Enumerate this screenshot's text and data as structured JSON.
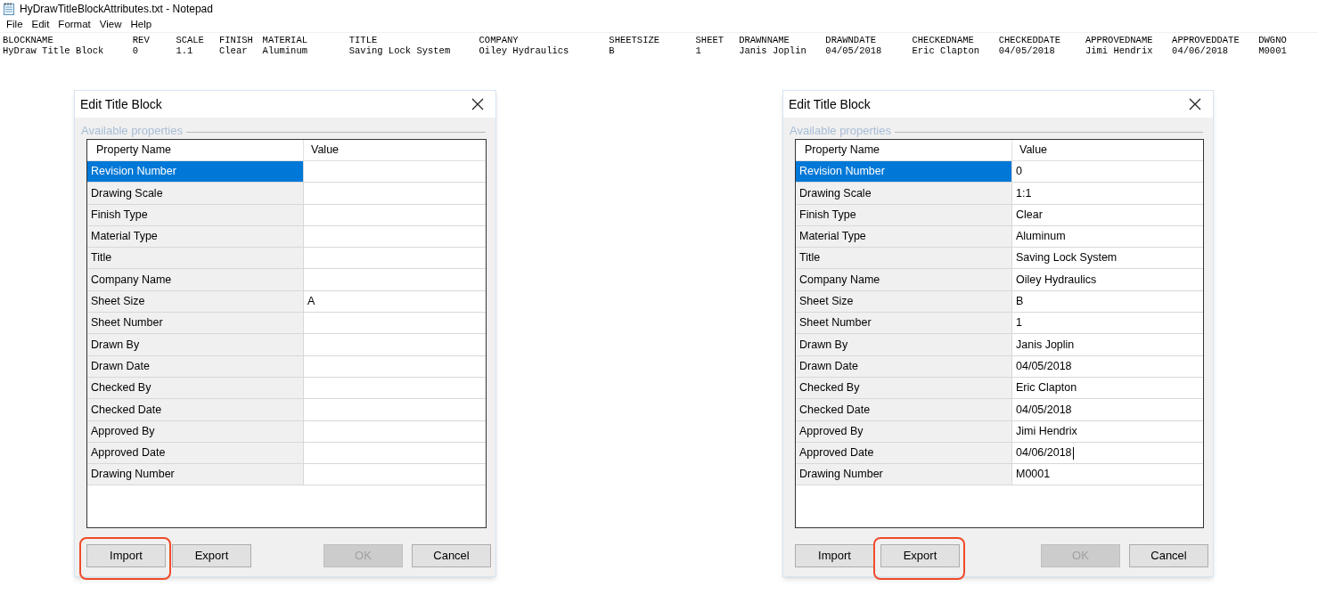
{
  "notepad": {
    "title": "HyDrawTitleBlockAttributes.txt - Notepad",
    "menu": [
      "File",
      "Edit",
      "Format",
      "View",
      "Help"
    ],
    "columns": [
      {
        "header": "BLOCKNAME",
        "value": "HyDraw Title Block"
      },
      {
        "header": "REV",
        "value": "0"
      },
      {
        "header": "SCALE",
        "value": "1.1"
      },
      {
        "header": "FINISH",
        "value": "Clear"
      },
      {
        "header": "MATERIAL",
        "value": "Aluminum"
      },
      {
        "header": "TITLE",
        "value": "Saving Lock System"
      },
      {
        "header": "COMPANY",
        "value": "Oiley Hydraulics"
      },
      {
        "header": "SHEETSIZE",
        "value": "B"
      },
      {
        "header": "SHEET",
        "value": "1"
      },
      {
        "header": "DRAWNNAME",
        "value": "Janis Joplin"
      },
      {
        "header": "DRAWNDATE",
        "value": "04/05/2018"
      },
      {
        "header": "CHECKEDNAME",
        "value": "Eric Clapton"
      },
      {
        "header": "CHECKEDDATE",
        "value": "04/05/2018"
      },
      {
        "header": "APPROVEDNAME",
        "value": "Jimi Hendrix"
      },
      {
        "header": "APPROVEDDATE",
        "value": "04/06/2018"
      },
      {
        "header": "DWGNO",
        "value": "M0001"
      }
    ]
  },
  "dialogs": [
    {
      "title": "Edit Title Block",
      "group_label": "Available properties",
      "columns": [
        "Property Name",
        "Value"
      ],
      "rows": [
        {
          "name": "Revision Number",
          "value": "",
          "selected": true,
          "caret": false
        },
        {
          "name": "Drawing Scale",
          "value": "",
          "selected": false,
          "caret": false
        },
        {
          "name": "Finish Type",
          "value": "",
          "selected": false,
          "caret": false
        },
        {
          "name": "Material Type",
          "value": "",
          "selected": false,
          "caret": false
        },
        {
          "name": "Title",
          "value": "",
          "selected": false,
          "caret": false
        },
        {
          "name": "Company Name",
          "value": "",
          "selected": false,
          "caret": false
        },
        {
          "name": "Sheet Size",
          "value": "A",
          "selected": false,
          "caret": false
        },
        {
          "name": "Sheet Number",
          "value": "",
          "selected": false,
          "caret": false
        },
        {
          "name": "Drawn By",
          "value": "",
          "selected": false,
          "caret": false
        },
        {
          "name": "Drawn Date",
          "value": "",
          "selected": false,
          "caret": false
        },
        {
          "name": "Checked By",
          "value": "",
          "selected": false,
          "caret": false
        },
        {
          "name": "Checked Date",
          "value": "",
          "selected": false,
          "caret": false
        },
        {
          "name": "Approved By",
          "value": "",
          "selected": false,
          "caret": false
        },
        {
          "name": "Approved Date",
          "value": "",
          "selected": false,
          "caret": false
        },
        {
          "name": "Drawing Number",
          "value": "",
          "selected": false,
          "caret": false
        }
      ],
      "buttons": [
        {
          "label": "Import",
          "disabled": false,
          "highlighted": true
        },
        {
          "label": "Export",
          "disabled": false,
          "highlighted": false
        },
        {
          "label": "OK",
          "disabled": true,
          "highlighted": false
        },
        {
          "label": "Cancel",
          "disabled": false,
          "highlighted": false
        }
      ]
    },
    {
      "title": "Edit Title Block",
      "group_label": "Available properties",
      "columns": [
        "Property Name",
        "Value"
      ],
      "rows": [
        {
          "name": "Revision Number",
          "value": "0",
          "selected": true,
          "caret": false
        },
        {
          "name": "Drawing Scale",
          "value": "1:1",
          "selected": false,
          "caret": false
        },
        {
          "name": "Finish Type",
          "value": "Clear",
          "selected": false,
          "caret": false
        },
        {
          "name": "Material Type",
          "value": "Aluminum",
          "selected": false,
          "caret": false
        },
        {
          "name": "Title",
          "value": "Saving Lock System",
          "selected": false,
          "caret": false
        },
        {
          "name": "Company Name",
          "value": "Oiley Hydraulics",
          "selected": false,
          "caret": false
        },
        {
          "name": "Sheet Size",
          "value": "B",
          "selected": false,
          "caret": false
        },
        {
          "name": "Sheet Number",
          "value": "1",
          "selected": false,
          "caret": false
        },
        {
          "name": "Drawn By",
          "value": "Janis Joplin",
          "selected": false,
          "caret": false
        },
        {
          "name": "Drawn Date",
          "value": "04/05/2018",
          "selected": false,
          "caret": false
        },
        {
          "name": "Checked By",
          "value": "Eric Clapton",
          "selected": false,
          "caret": false
        },
        {
          "name": "Checked Date",
          "value": "04/05/2018",
          "selected": false,
          "caret": false
        },
        {
          "name": "Approved By",
          "value": "Jimi Hendrix",
          "selected": false,
          "caret": false
        },
        {
          "name": "Approved Date",
          "value": "04/06/2018",
          "selected": false,
          "caret": true
        },
        {
          "name": "Drawing Number",
          "value": "M0001",
          "selected": false,
          "caret": false
        }
      ],
      "buttons": [
        {
          "label": "Import",
          "disabled": false,
          "highlighted": false
        },
        {
          "label": "Export",
          "disabled": false,
          "highlighted": true
        },
        {
          "label": "OK",
          "disabled": true,
          "highlighted": false
        },
        {
          "label": "Cancel",
          "disabled": false,
          "highlighted": false
        }
      ]
    }
  ]
}
